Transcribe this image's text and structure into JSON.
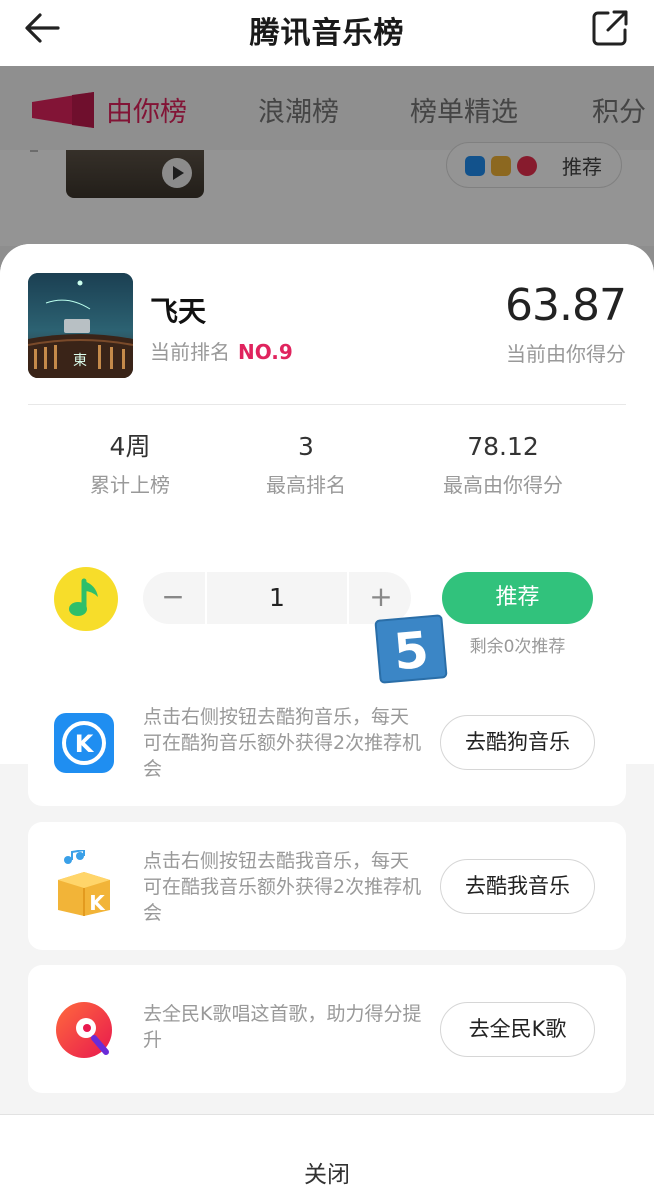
{
  "header": {
    "title": "腾讯音乐榜"
  },
  "tabs": [
    {
      "label": "由你榜",
      "active": true
    },
    {
      "label": "浪潮榜",
      "active": false
    },
    {
      "label": "榜单精选",
      "active": false
    },
    {
      "label": "积分",
      "active": false
    }
  ],
  "background_row": {
    "recommend_label": "推荐"
  },
  "song": {
    "name": "飞天",
    "rank_prefix": "当前排名",
    "rank": "NO.9",
    "score": "63.87",
    "score_label": "当前由你得分",
    "cover_text": "東"
  },
  "stats": [
    {
      "value": "4周",
      "label": "累计上榜"
    },
    {
      "value": "3",
      "label": "最高排名"
    },
    {
      "value": "78.12",
      "label": "最高由你得分"
    }
  ],
  "vote": {
    "minus": "−",
    "quantity": "1",
    "plus": "+",
    "button": "推荐",
    "remaining": "剩余0次推荐",
    "badge": "5"
  },
  "apps": [
    {
      "icon": "kugou-icon",
      "desc": "点击右侧按钮去酷狗音乐，每天可在酷狗音乐额外获得2次推荐机会",
      "button": "去酷狗音乐"
    },
    {
      "icon": "kuwo-icon",
      "desc": "点击右侧按钮去酷我音乐，每天可在酷我音乐额外获得2次推荐机会",
      "button": "去酷我音乐"
    },
    {
      "icon": "quanmin-k-song-icon",
      "desc": "去全民K歌唱这首歌，助力得分提升",
      "button": "去全民K歌"
    }
  ],
  "footer": {
    "close": "关闭"
  },
  "colors": {
    "accent_pink": "#e0245e",
    "green": "#31c27c",
    "kugou_blue": "#1f8ef1",
    "qq_yellow": "#f7dd2a"
  }
}
